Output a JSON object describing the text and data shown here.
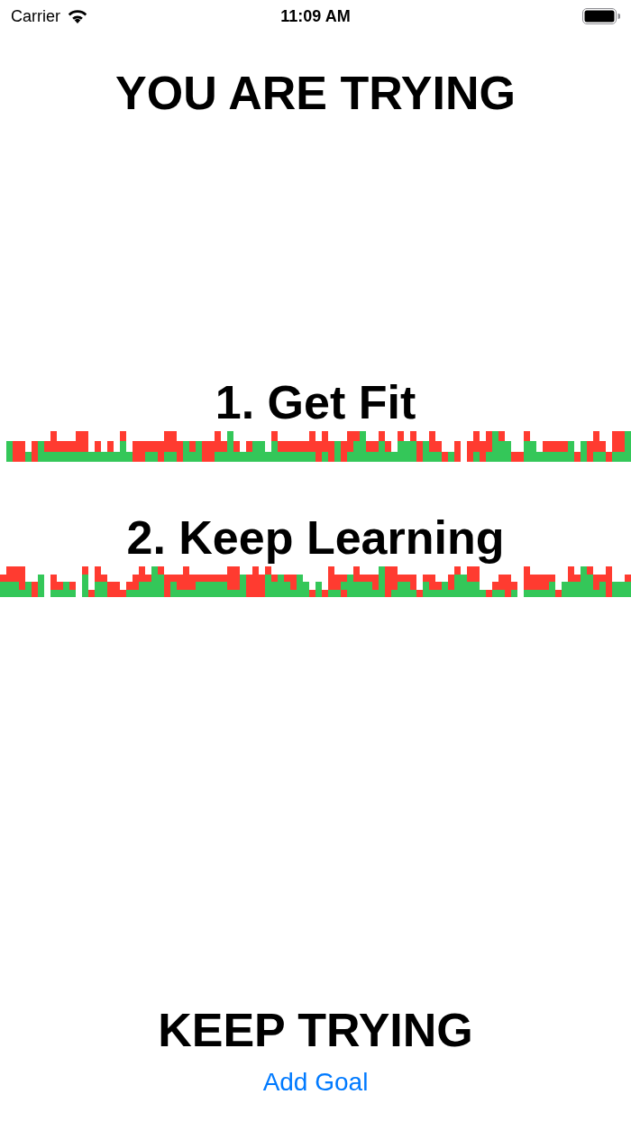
{
  "status_bar": {
    "carrier": "Carrier",
    "time": "11:09 AM"
  },
  "title": "YOU ARE TRYING",
  "goals": [
    {
      "label": "1. Get Fit"
    },
    {
      "label": "2. Keep Learning"
    }
  ],
  "footer": {
    "message": "KEEP TRYING",
    "add_button": "Add Goal"
  }
}
